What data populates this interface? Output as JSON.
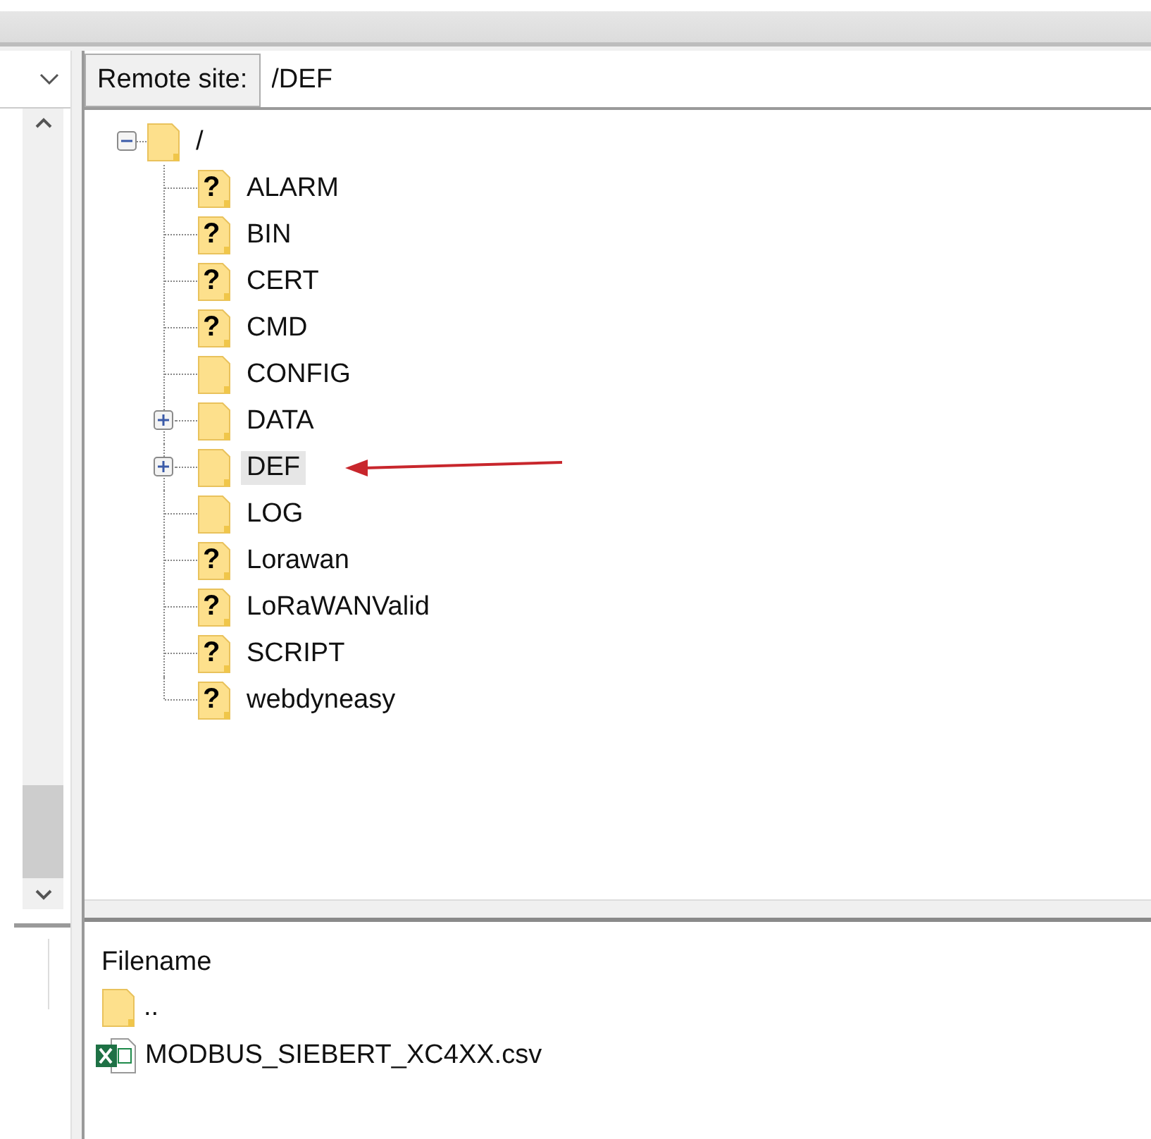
{
  "remote_site": {
    "label": "Remote site:",
    "path": "/DEF"
  },
  "tree": {
    "label": "/",
    "expanded": true,
    "children": [
      {
        "label": "ALARM",
        "badge": "?",
        "has_children": false,
        "selected": false
      },
      {
        "label": "BIN",
        "badge": "?",
        "has_children": false,
        "selected": false
      },
      {
        "label": "CERT",
        "badge": "?",
        "has_children": false,
        "selected": false
      },
      {
        "label": "CMD",
        "badge": "?",
        "has_children": false,
        "selected": false
      },
      {
        "label": "CONFIG",
        "has_children": false,
        "selected": false
      },
      {
        "label": "DATA",
        "has_children": true,
        "selected": false
      },
      {
        "label": "DEF",
        "has_children": true,
        "selected": true
      },
      {
        "label": "LOG",
        "has_children": false,
        "selected": false
      },
      {
        "label": "Lorawan",
        "badge": "?",
        "has_children": false,
        "selected": false
      },
      {
        "label": "LoRaWANValid",
        "badge": "?",
        "has_children": false,
        "selected": false
      },
      {
        "label": "SCRIPT",
        "badge": "?",
        "has_children": false,
        "selected": false
      },
      {
        "label": "webdyneasy",
        "badge": "?",
        "has_children": false,
        "selected": false
      }
    ]
  },
  "file_list": {
    "columns": [
      "Filename"
    ],
    "rows": [
      {
        "name": "..",
        "kind": "folder"
      },
      {
        "name": "MODBUS_SIEBERT_XC4XX.csv",
        "kind": "spreadsheet"
      }
    ]
  }
}
